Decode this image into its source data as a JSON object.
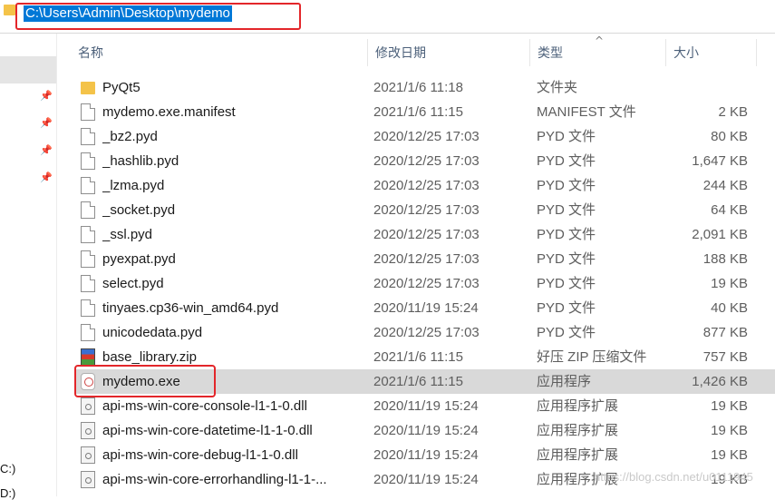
{
  "address_bar": {
    "path": "C:\\Users\\Admin\\Desktop\\mydemo"
  },
  "nav": {
    "drives": [
      "C:)",
      "D:)"
    ]
  },
  "columns": {
    "name": "名称",
    "date": "修改日期",
    "type": "类型",
    "size": "大小"
  },
  "files": [
    {
      "name": "PyQt5",
      "date": "2021/1/6 11:18",
      "type": "文件夹",
      "size": "",
      "icon": "folder-icon"
    },
    {
      "name": "mydemo.exe.manifest",
      "date": "2021/1/6 11:15",
      "type": "MANIFEST 文件",
      "size": "2 KB",
      "icon": "file-icon"
    },
    {
      "name": "_bz2.pyd",
      "date": "2020/12/25 17:03",
      "type": "PYD 文件",
      "size": "80 KB",
      "icon": "file-icon"
    },
    {
      "name": "_hashlib.pyd",
      "date": "2020/12/25 17:03",
      "type": "PYD 文件",
      "size": "1,647 KB",
      "icon": "file-icon"
    },
    {
      "name": "_lzma.pyd",
      "date": "2020/12/25 17:03",
      "type": "PYD 文件",
      "size": "244 KB",
      "icon": "file-icon"
    },
    {
      "name": "_socket.pyd",
      "date": "2020/12/25 17:03",
      "type": "PYD 文件",
      "size": "64 KB",
      "icon": "file-icon"
    },
    {
      "name": "_ssl.pyd",
      "date": "2020/12/25 17:03",
      "type": "PYD 文件",
      "size": "2,091 KB",
      "icon": "file-icon"
    },
    {
      "name": "pyexpat.pyd",
      "date": "2020/12/25 17:03",
      "type": "PYD 文件",
      "size": "188 KB",
      "icon": "file-icon"
    },
    {
      "name": "select.pyd",
      "date": "2020/12/25 17:03",
      "type": "PYD 文件",
      "size": "19 KB",
      "icon": "file-icon"
    },
    {
      "name": "tinyaes.cp36-win_amd64.pyd",
      "date": "2020/11/19 15:24",
      "type": "PYD 文件",
      "size": "40 KB",
      "icon": "file-icon"
    },
    {
      "name": "unicodedata.pyd",
      "date": "2020/12/25 17:03",
      "type": "PYD 文件",
      "size": "877 KB",
      "icon": "file-icon"
    },
    {
      "name": "base_library.zip",
      "date": "2021/1/6 11:15",
      "type": "好压 ZIP 压缩文件",
      "size": "757 KB",
      "icon": "zip-archive-icon"
    },
    {
      "name": "mydemo.exe",
      "date": "2021/1/6 11:15",
      "type": "应用程序",
      "size": "1,426 KB",
      "icon": "application-icon"
    },
    {
      "name": "api-ms-win-core-console-l1-1-0.dll",
      "date": "2020/11/19 15:24",
      "type": "应用程序扩展",
      "size": "19 KB",
      "icon": "dll-icon"
    },
    {
      "name": "api-ms-win-core-datetime-l1-1-0.dll",
      "date": "2020/11/19 15:24",
      "type": "应用程序扩展",
      "size": "19 KB",
      "icon": "dll-icon"
    },
    {
      "name": "api-ms-win-core-debug-l1-1-0.dll",
      "date": "2020/11/19 15:24",
      "type": "应用程序扩展",
      "size": "19 KB",
      "icon": "dll-icon"
    },
    {
      "name": "api-ms-win-core-errorhandling-l1-1-...",
      "date": "2020/11/19 15:24",
      "type": "应用程序扩展",
      "size": "19 KB",
      "icon": "dll-icon"
    }
  ],
  "selected_index": 12,
  "watermark": "https://blog.csdn.net/u0111945",
  "colors": {
    "selection": "#0078d7",
    "annotation": "#e3262a",
    "row_selected": "#d9d9d9"
  }
}
